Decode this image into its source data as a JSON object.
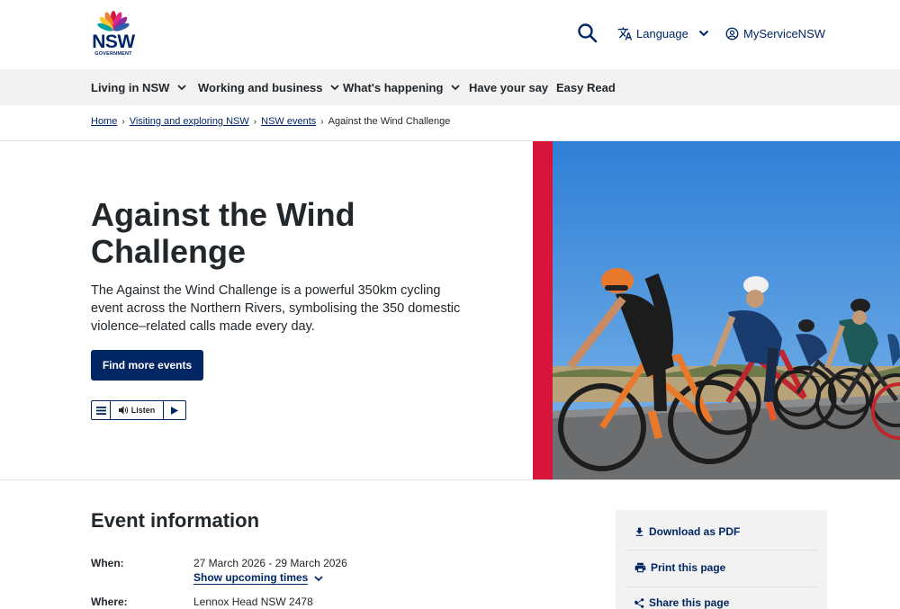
{
  "header": {
    "logo": {
      "wordmark": "NSW",
      "sub": "GOVERNMENT"
    },
    "language_label": "Language",
    "myservice_label": "MyServiceNSW"
  },
  "nav": {
    "items": [
      {
        "label": "Living in NSW",
        "has_dropdown": true
      },
      {
        "label": "Working and business",
        "has_dropdown": true
      },
      {
        "label": "What's happening",
        "has_dropdown": true
      },
      {
        "label": "Have your say",
        "has_dropdown": false
      },
      {
        "label": "Easy Read",
        "has_dropdown": false
      }
    ]
  },
  "breadcrumb": {
    "items": [
      "Home",
      "Visiting and exploring NSW",
      "NSW events"
    ],
    "current": "Against the Wind Challenge"
  },
  "hero": {
    "title": "Against the Wind Challenge",
    "description": "The Against the Wind Challenge is a powerful 350km cycling event across the Northern Rivers, symbolising the 350 domestic violence–related calls made every day.",
    "button_label": "Find more events",
    "listen_label": "Listen"
  },
  "event_info": {
    "title": "Event information",
    "when_label": "When:",
    "when_value": "27 March 2026 - 29 March 2026",
    "show_times_label": "Show upcoming times",
    "where_label": "Where:",
    "where_value": "Lennox Head NSW 2478"
  },
  "side_panel": {
    "download_label": "Download as PDF",
    "print_label": "Print this page",
    "share_label": "Share this page"
  },
  "colors": {
    "brand_navy": "#002664",
    "accent_red": "#d7153a",
    "nav_bg": "#f2f2f2",
    "sky": "#3b8fd9"
  }
}
